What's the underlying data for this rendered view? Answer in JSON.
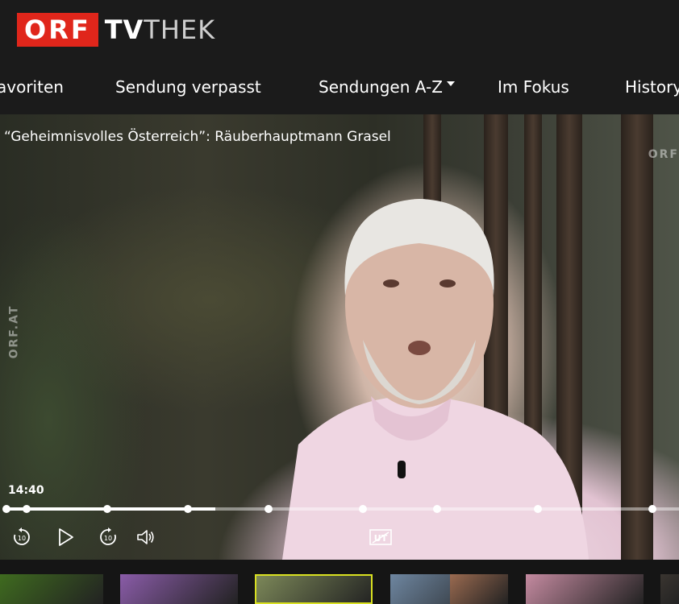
{
  "brand": {
    "logo_box": "ORF",
    "logo_tv": "TV",
    "logo_thek": "THEK",
    "accent": "#e0261b"
  },
  "nav": [
    {
      "label": "avoriten"
    },
    {
      "label": "Sendung verpasst"
    },
    {
      "label": "Sendungen A-Z",
      "dropdown": true
    },
    {
      "label": "Im Fokus"
    },
    {
      "label": "History"
    }
  ],
  "player": {
    "title": "“Geheimnisvolles Österreich”: Räuberhauptmann Grasel",
    "watermark_right": "ORF",
    "watermark_left": "ORF.AT",
    "current_time": "14:40",
    "progress_fraction": 0.31,
    "chapter_marks": [
      0.0,
      0.03,
      0.15,
      0.27,
      0.39,
      0.53,
      0.64,
      0.79,
      0.96
    ],
    "controls": {
      "rewind": "rewind-10-icon",
      "play": "play-icon",
      "forward": "forward-10-icon",
      "volume": "volume-icon",
      "subtitles": "subtitles-icon",
      "subtitles_label": "UT",
      "skip_seconds": "10"
    }
  },
  "thumbnails": [
    {
      "name": "green-scene",
      "color": "#3f6b1f"
    },
    {
      "name": "stage-scene",
      "color": "#8a5ca8"
    },
    {
      "name": "forest-scene",
      "color": "#7e8a5a",
      "selected": true
    },
    {
      "name": "studio-scene",
      "color": "#6e86a0"
    },
    {
      "name": "kitchen-scene",
      "color": "#9a6a50"
    },
    {
      "name": "show-scene",
      "color": "#c48aa0"
    },
    {
      "name": "dark-scene",
      "color": "#3a3530"
    }
  ]
}
